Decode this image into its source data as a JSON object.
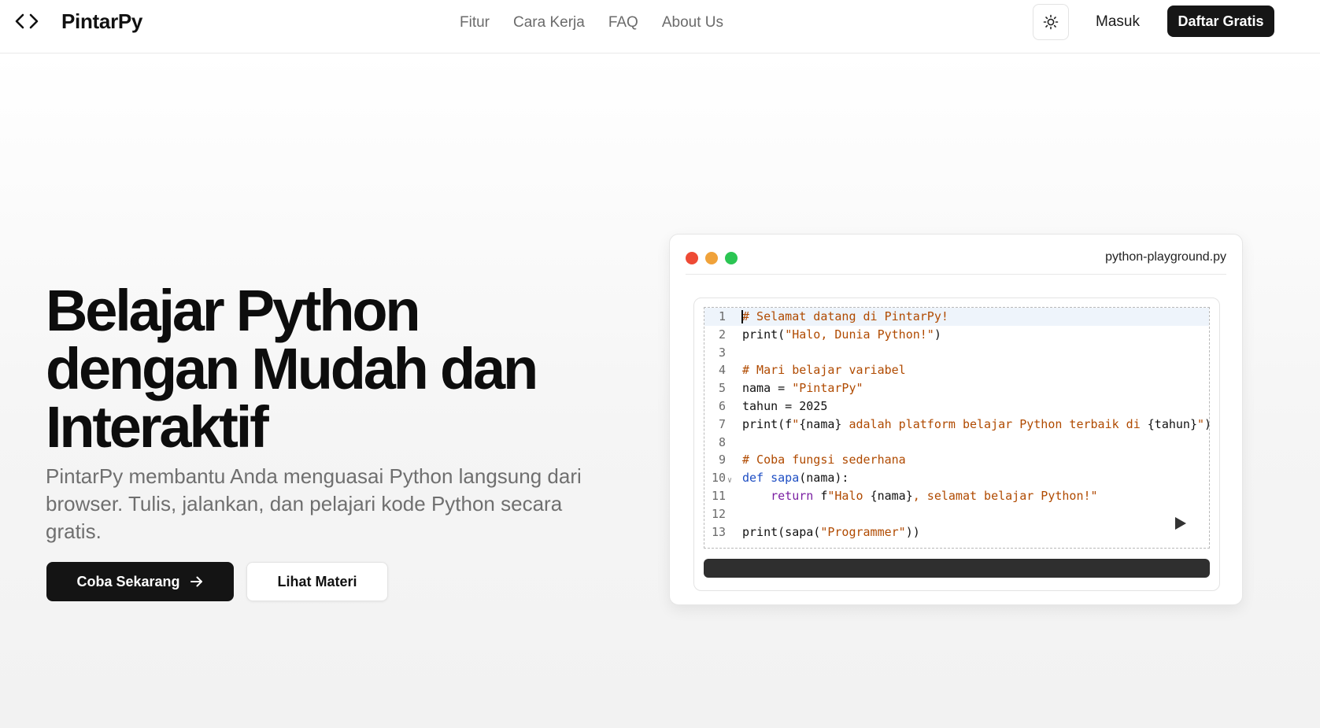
{
  "header": {
    "brand": "PintarPy",
    "logo_icon": "code-brackets-icon",
    "nav": [
      "Fitur",
      "Cara Kerja",
      "FAQ",
      "About Us"
    ],
    "theme_toggle_icon": "sun-icon",
    "login_label": "Masuk",
    "signup_label": "Daftar Gratis"
  },
  "hero": {
    "title_lines": [
      "Belajar Python",
      "dengan Mudah dan",
      "Interaktif"
    ],
    "subtitle": "PintarPy membantu Anda menguasai Python langsung dari browser. Tulis, jalankan, dan pelajari kode Python secara gratis.",
    "primary_cta": "Coba Sekarang",
    "primary_cta_icon": "arrow-right-icon",
    "secondary_cta": "Lihat Materi"
  },
  "playground": {
    "filename": "python-playground.py",
    "window_dot_colors": [
      "#ee4a35",
      "#f0a23a",
      "#2bc553"
    ],
    "run_icon": "play-icon",
    "active_line": 1,
    "lines": [
      {
        "n": "1",
        "text": "# Selamat datang di PintarPy!"
      },
      {
        "n": "2",
        "text": "print(\"Halo, Dunia Python!\")"
      },
      {
        "n": "3",
        "text": ""
      },
      {
        "n": "4",
        "text": "# Mari belajar variabel"
      },
      {
        "n": "5",
        "text": "nama = \"PintarPy\""
      },
      {
        "n": "6",
        "text": "tahun = 2025"
      },
      {
        "n": "7",
        "text": "print(f\"{nama} adalah platform belajar Python terbaik di {tahun}\")"
      },
      {
        "n": "8",
        "text": ""
      },
      {
        "n": "9",
        "text": "# Coba fungsi sederhana"
      },
      {
        "n": "10",
        "text": "def sapa(nama):"
      },
      {
        "n": "11",
        "text": "    return f\"Halo {nama}, selamat belajar Python!\""
      },
      {
        "n": "12",
        "text": ""
      },
      {
        "n": "13",
        "text": "print(sapa(\"Programmer\"))"
      }
    ]
  }
}
